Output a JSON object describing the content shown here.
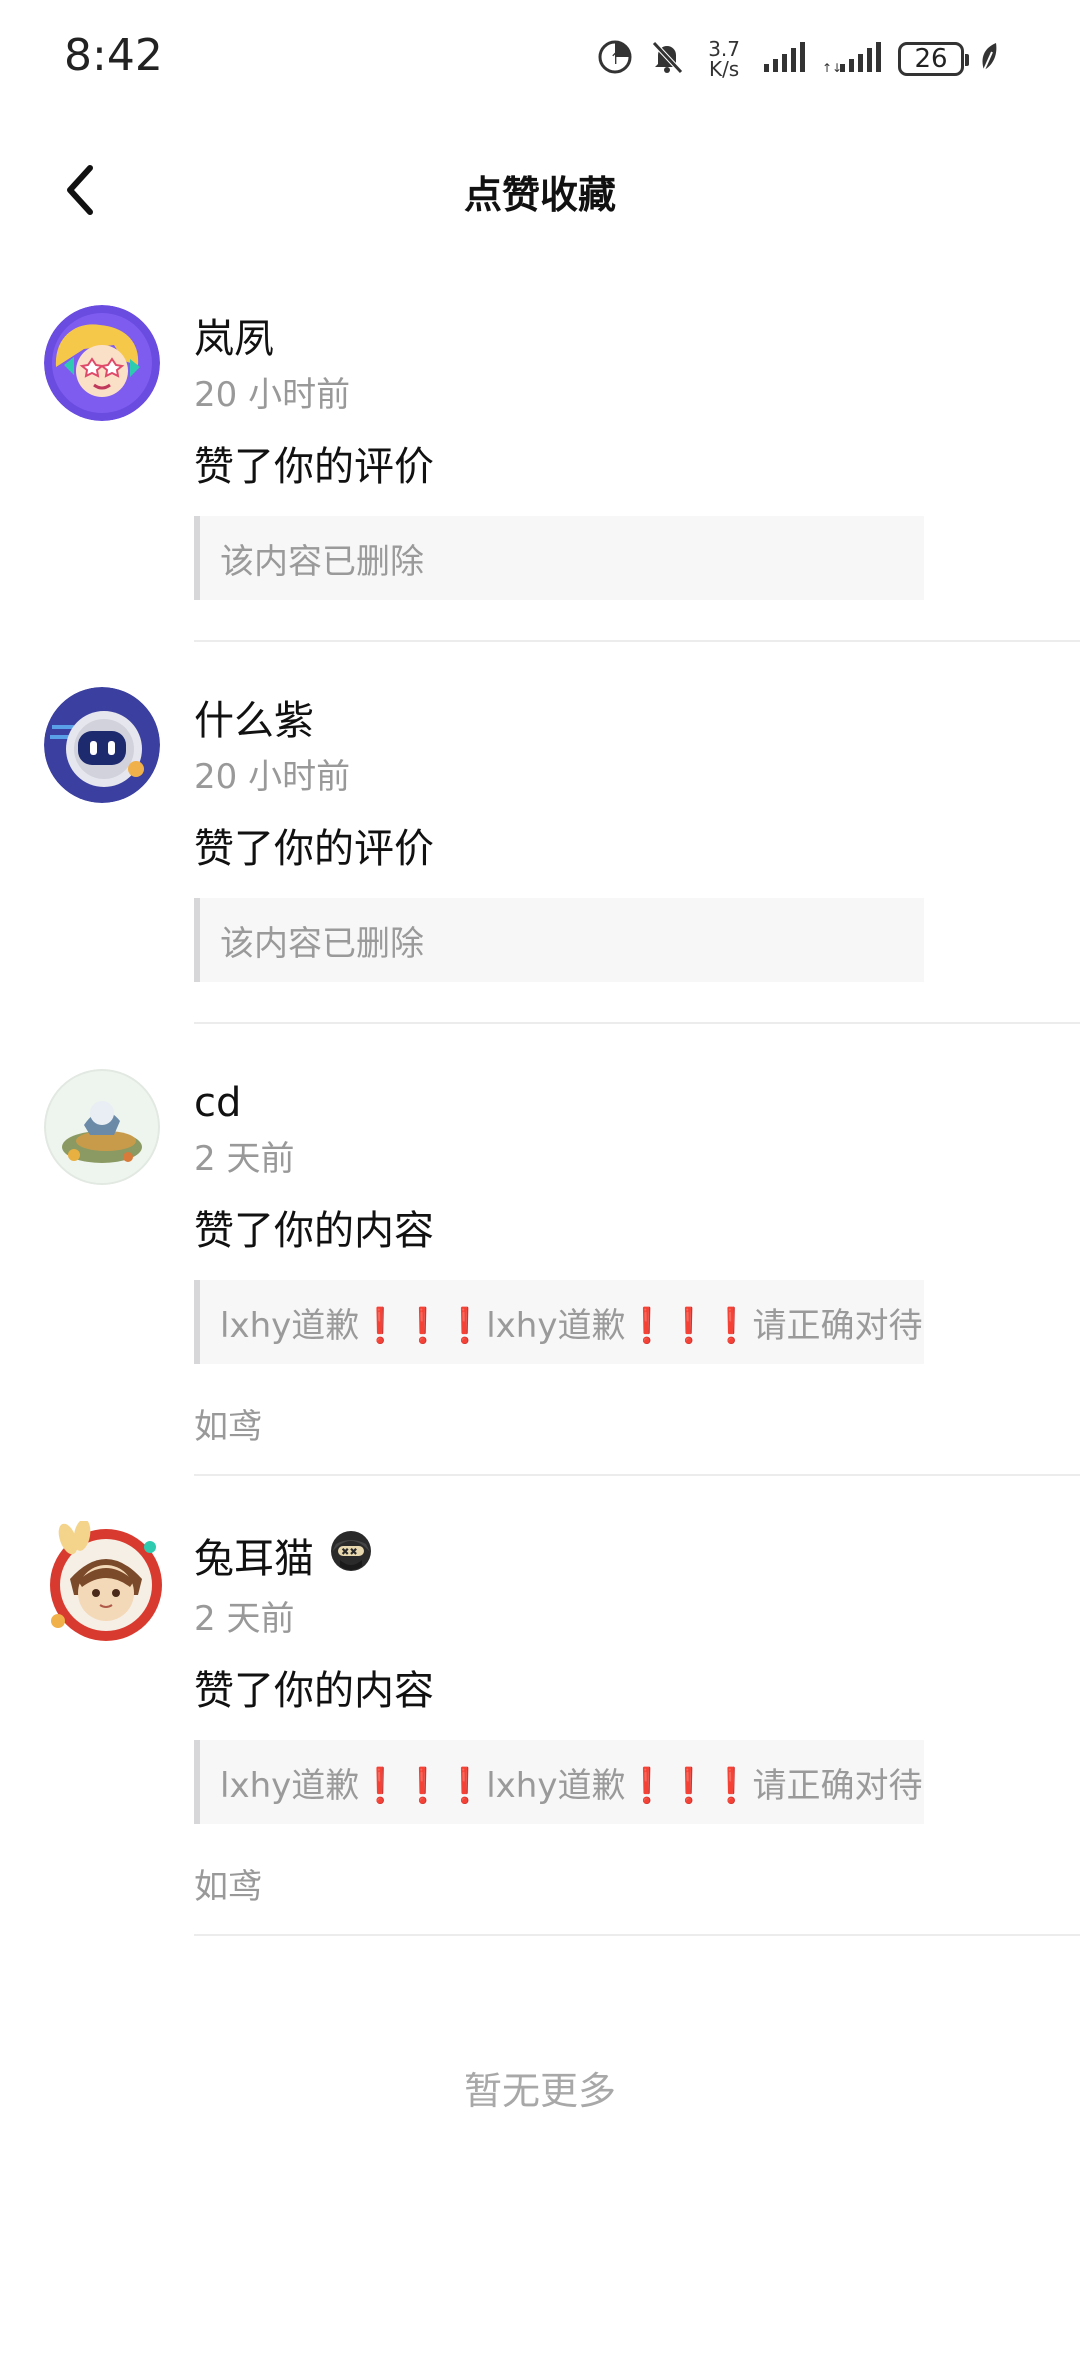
{
  "status_bar": {
    "time": "8:42",
    "net_speed_value": "3.7",
    "net_speed_unit": "K/s",
    "battery": "26",
    "icons": [
      "data-saver-icon",
      "mute-icon",
      "signal-1-icon",
      "signal-2-icon",
      "battery-icon",
      "leaf-icon"
    ]
  },
  "header": {
    "title": "点赞收藏",
    "back_icon": "chevron-left-icon"
  },
  "items": [
    {
      "username": "岚夙",
      "time": "20 小时前",
      "action": "赞了你的评价",
      "quote": "该内容已删除",
      "source": "",
      "avatar_colors": [
        "#6a4ce0",
        "#f5c84a"
      ]
    },
    {
      "username": "什么紫",
      "time": "20 小时前",
      "action": "赞了你的评价",
      "quote": "该内容已删除",
      "source": "",
      "avatar_colors": [
        "#3a3fa0",
        "#e0e0ea"
      ]
    },
    {
      "username": "cd",
      "time": "2 天前",
      "action": "赞了你的内容",
      "quote": "lxhy道歉❗❗❗lxhy道歉❗❗❗请正确对待…",
      "source": "如鸢",
      "avatar_colors": [
        "#eef4ee",
        "#c89b4a"
      ]
    },
    {
      "username": "兔耳猫",
      "time": "2 天前",
      "action": "赞了你的内容",
      "quote": "lxhy道歉❗❗❗lxhy道歉❗❗❗请正确对待…",
      "source": "如鸢",
      "avatar_colors": [
        "#d93a2f",
        "#f3d9b8"
      ],
      "badge_icon": "dark-mask-badge-icon"
    }
  ],
  "footer": {
    "no_more": "暂无更多"
  }
}
